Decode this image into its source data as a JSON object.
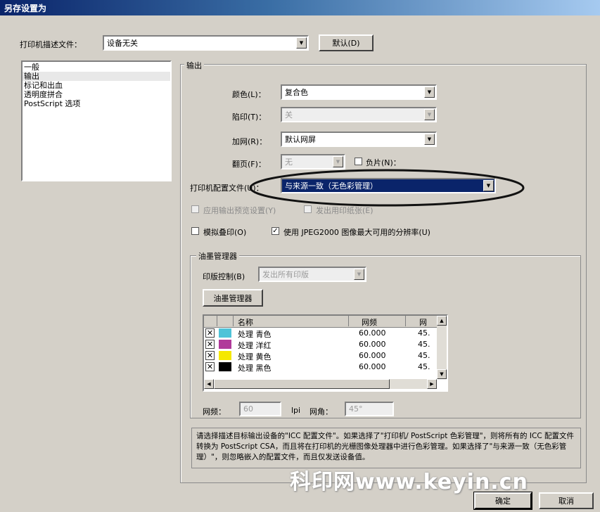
{
  "window": {
    "title": "另存设置为"
  },
  "ppd": {
    "label": "打印机描述文件：",
    "value": "设备无关",
    "default_button": "默认(D)"
  },
  "categories": [
    "一般",
    "输出",
    "标记和出血",
    "透明度拼合",
    "PostScript 选项"
  ],
  "output": {
    "group_label": "输出",
    "color": {
      "label": "颜色(L)：",
      "value": "复合色"
    },
    "trapping": {
      "label": "陷印(T)：",
      "value": "关"
    },
    "screening": {
      "label": "加网(R)：",
      "value": "默认网屏"
    },
    "flip": {
      "label": "翻页(F)：",
      "value": "无"
    },
    "negative": {
      "label": "负片(N)："
    },
    "printer_profile": {
      "label": "打印机配置文件(U)：",
      "value": "与来源一致（无色彩管理）"
    },
    "apply_preview": {
      "label": "应用输出预览设置(Y)"
    },
    "send_printer_marks": {
      "label": "发出用印纸张(E)"
    },
    "simulate_overprint": {
      "label": "模拟叠印(O)"
    },
    "jpeg2000": {
      "label": "使用 JPEG2000 图像最大可用的分辨率(U)"
    }
  },
  "ink_manager": {
    "group_label": "油墨管理器",
    "plate_control": {
      "label": "印版控制(B)",
      "value": "发出所有印版"
    },
    "button_label": "油墨管理器",
    "columns": [
      "名称",
      "网频",
      "网"
    ],
    "rows": [
      {
        "name": "处理 青色",
        "freq": "60.000",
        "angle": "45.",
        "color": "#4fc3d8"
      },
      {
        "name": "处理 洋红",
        "freq": "60.000",
        "angle": "45.",
        "color": "#b03a9a"
      },
      {
        "name": "处理 黄色",
        "freq": "60.000",
        "angle": "45.",
        "color": "#f5e800"
      },
      {
        "name": "处理 黑色",
        "freq": "60.000",
        "angle": "45.",
        "color": "#000000"
      }
    ],
    "freq_label": "网频：",
    "freq_value": "60",
    "lpi_label": "lpi",
    "angle_label": "网角：",
    "angle_value": "45°"
  },
  "description": "请选择描述目标输出设备的\"ICC 配置文件\"。如果选择了\"打印机/ PostScript 色彩管理\"，则将所有的 ICC 配置文件转换为 PostScript CSA，而且将在打印机的光栅图像处理器中进行色彩管理。如果选择了\"与来源一致（无色彩管理）\"，则忽略嵌入的配置文件，而且仅发送设备值。",
  "watermark": "科印网www.keyin.cn",
  "buttons": {
    "ok": "确定",
    "cancel": "取消"
  }
}
